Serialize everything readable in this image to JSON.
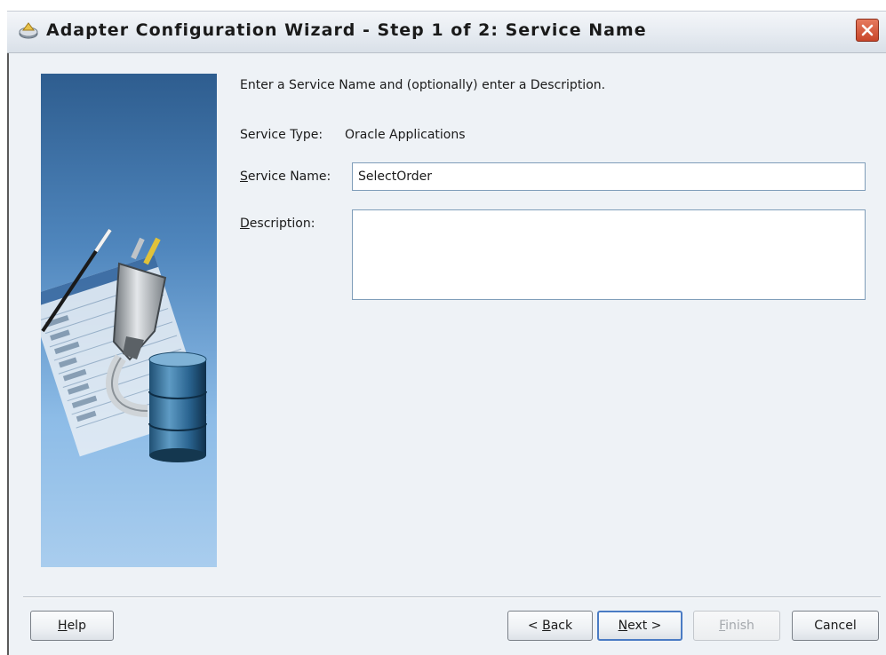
{
  "window": {
    "title": "Adapter Configuration Wizard - Step 1 of 2: Service Name"
  },
  "form": {
    "intro_text": "Enter a Service Name and (optionally) enter a Description.",
    "service_type_label": "Service Type:",
    "service_type_value": "Oracle Applications",
    "service_name_label_mnemonic": "S",
    "service_name_label_rest": "ervice Name:",
    "service_name_value": "SelectOrder",
    "description_label_mnemonic": "D",
    "description_label_rest": "escription:",
    "description_value": ""
  },
  "buttons": {
    "help_mnemonic": "H",
    "help_rest": "elp",
    "back_prefix": "< ",
    "back_mnemonic": "B",
    "back_rest": "ack",
    "next_mnemonic": "N",
    "next_rest": "ext >",
    "finish_mnemonic": "F",
    "finish_rest": "inish",
    "cancel_label": "Cancel"
  },
  "state": {
    "finish_enabled": false,
    "default_button": "next"
  },
  "icons": {
    "title": "wizard-icon",
    "close": "close-icon",
    "side": "adapter-plug-database-graphic"
  },
  "colors": {
    "panel_background": "#eef2f6",
    "side_graphic_top": "#2e5d8f",
    "side_graphic_bottom": "#a9cdee",
    "close_button": "#c8462a"
  }
}
